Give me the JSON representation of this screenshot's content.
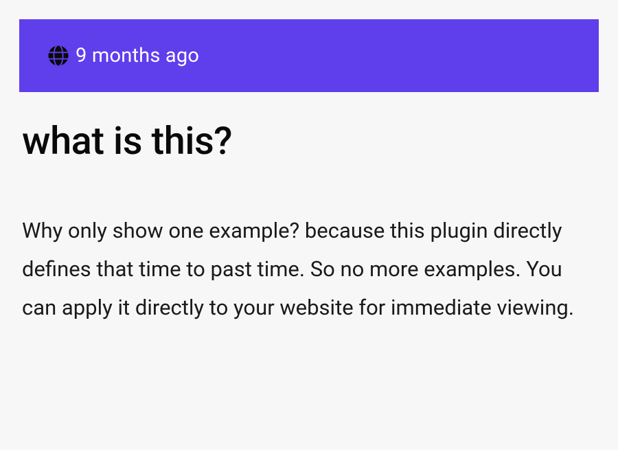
{
  "banner": {
    "timestamp": "9 months ago"
  },
  "content": {
    "heading": "what is this?",
    "paragraph": "Why only show one example? because this plugin directly defines that time to past time. So no more examples. You can apply it directly to your website for immediate viewing."
  }
}
